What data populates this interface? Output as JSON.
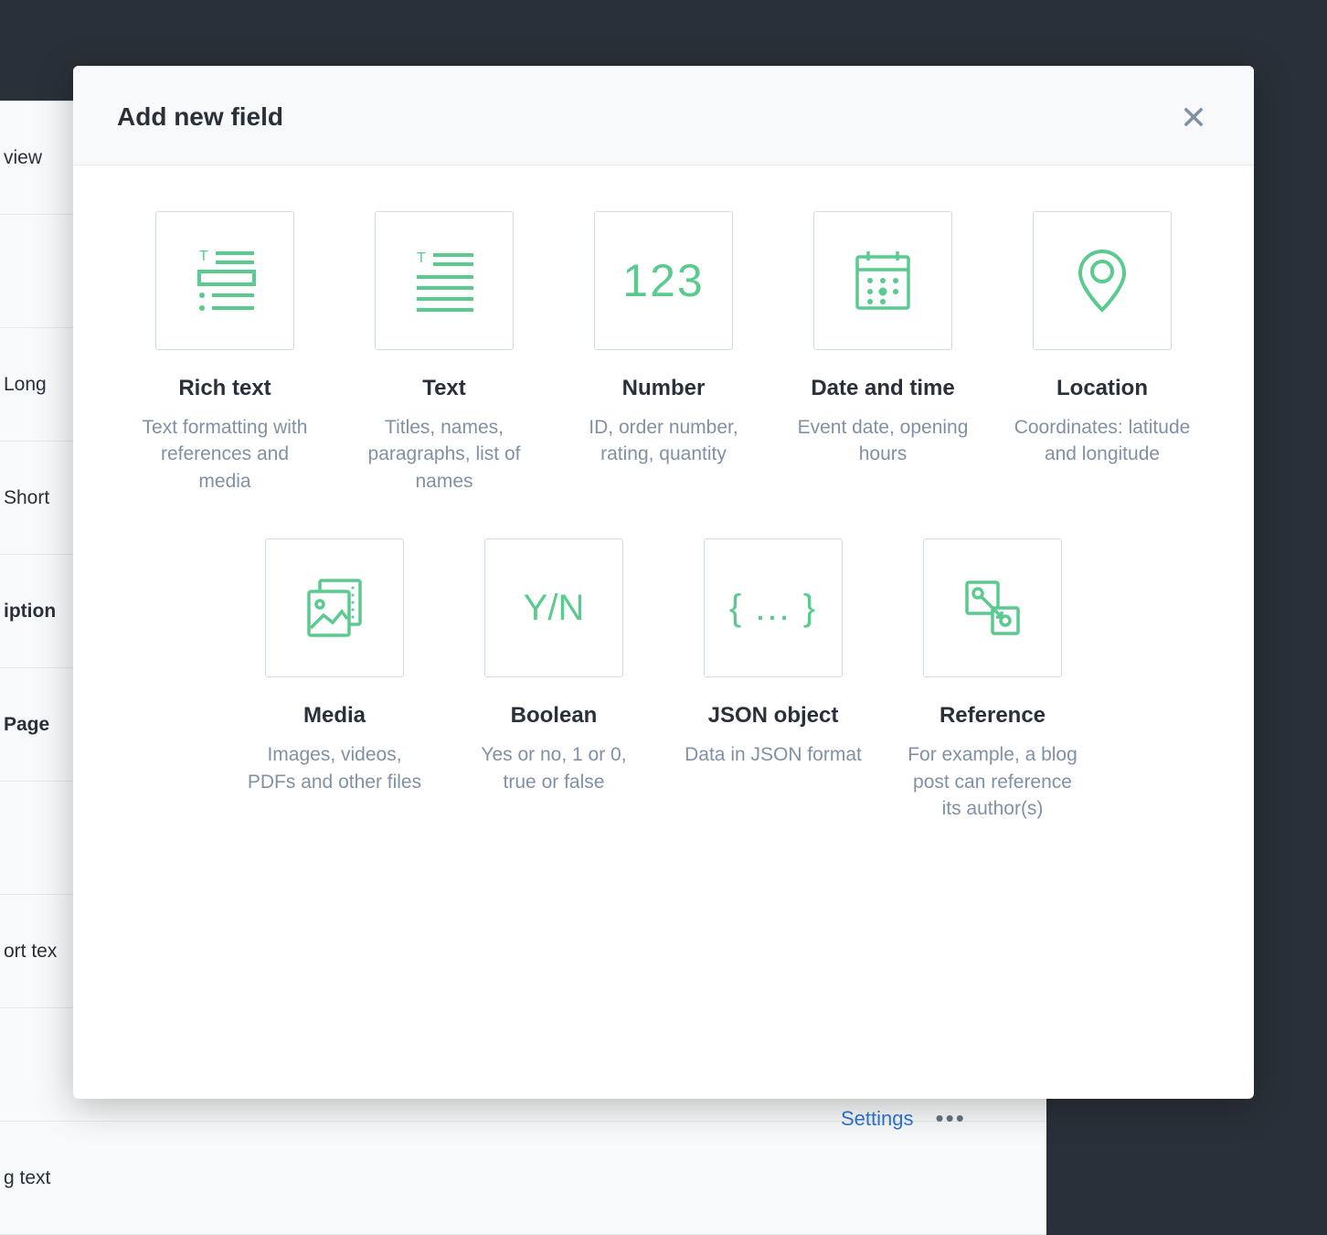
{
  "modal": {
    "title": "Add new field",
    "close_label": "Close"
  },
  "field_types": {
    "rich_text": {
      "title": "Rich text",
      "desc": "Text formatting with references and media"
    },
    "text": {
      "title": "Text",
      "desc": "Titles, names, paragraphs, list of names"
    },
    "number": {
      "title": "Number",
      "desc": "ID, order number, rating, quantity",
      "glyph": "123"
    },
    "date_time": {
      "title": "Date and time",
      "desc": "Event date, opening hours"
    },
    "location": {
      "title": "Location",
      "desc": "Coordinates: latitude and longitude"
    },
    "media": {
      "title": "Media",
      "desc": "Images, videos, PDFs and other files"
    },
    "boolean": {
      "title": "Boolean",
      "desc": "Yes or no, 1 or 0, true or false",
      "glyph": "Y/N"
    },
    "json": {
      "title": "JSON object",
      "desc": "Data in JSON format",
      "glyph": "{ ... }"
    },
    "reference": {
      "title": "Reference",
      "desc": "For example, a blog post can reference its author(s)"
    }
  },
  "background": {
    "rows": [
      "view",
      "",
      "Long",
      "Short",
      "iption",
      "Page",
      "",
      "ort tex",
      "",
      "g text"
    ],
    "settings_label": "Settings"
  }
}
